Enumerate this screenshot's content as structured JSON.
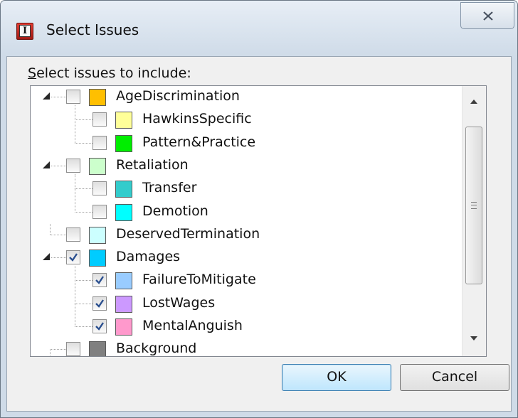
{
  "window": {
    "title": "Select Issues",
    "app_icon_letter": "I"
  },
  "prompt": {
    "access_key": "S",
    "rest": "elect issues to include:"
  },
  "tree": {
    "items": [
      {
        "label": "AgeDiscrimination",
        "level": 0,
        "expanded": true,
        "checked": false,
        "color": "#ffbf00"
      },
      {
        "label": "HawkinsSpecific",
        "level": 1,
        "checked": false,
        "color": "#ffff99"
      },
      {
        "label": "Pattern&Practice",
        "level": 1,
        "checked": false,
        "color": "#00ee00"
      },
      {
        "label": "Retaliation",
        "level": 0,
        "expanded": true,
        "checked": false,
        "color": "#ccffcc"
      },
      {
        "label": "Transfer",
        "level": 1,
        "checked": false,
        "color": "#33cccc"
      },
      {
        "label": "Demotion",
        "level": 1,
        "checked": false,
        "color": "#00ffff"
      },
      {
        "label": "DeservedTermination",
        "level": 0,
        "expanded": false,
        "checked": false,
        "color": "#ccffff"
      },
      {
        "label": "Damages",
        "level": 0,
        "expanded": true,
        "checked": true,
        "color": "#00ccff"
      },
      {
        "label": "FailureToMitigate",
        "level": 1,
        "checked": true,
        "color": "#99ccff"
      },
      {
        "label": "LostWages",
        "level": 1,
        "checked": true,
        "color": "#cc99ff"
      },
      {
        "label": "MentalAnguish",
        "level": 1,
        "checked": true,
        "color": "#ff99cc"
      },
      {
        "label": "Background",
        "level": 0,
        "expanded": false,
        "checked": false,
        "color": "#808080"
      }
    ]
  },
  "buttons": {
    "ok": "OK",
    "cancel": "Cancel"
  }
}
